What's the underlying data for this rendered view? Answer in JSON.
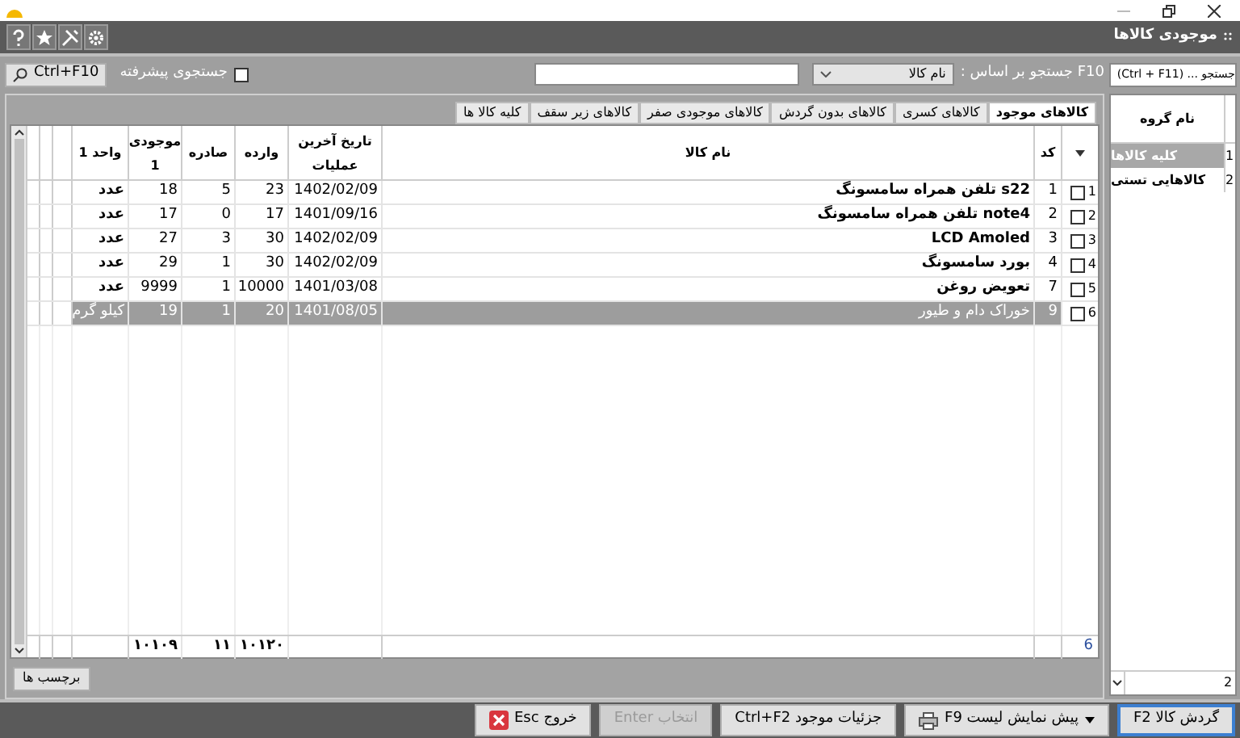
{
  "window": {
    "title": "موجودی کالاها"
  },
  "search": {
    "label": "F10 جستجو بر اساس :",
    "field_select": "نام کالا",
    "advanced_label": "جستجوی پیشرفته",
    "advanced_checked": false,
    "button": "Ctrl+F10",
    "group_placeholder": "جستجو ... (Ctrl + F11)"
  },
  "tabs": [
    {
      "label": "کالاهای موجود",
      "selected": true
    },
    {
      "label": "کالاهای کسری",
      "selected": false
    },
    {
      "label": "کالاهای بدون گردش",
      "selected": false
    },
    {
      "label": "کالاهای موجودی صفر",
      "selected": false
    },
    {
      "label": "کالاهای زیر سقف",
      "selected": false
    },
    {
      "label": "کلیه کالا ها",
      "selected": false
    }
  ],
  "table": {
    "columns": [
      "کد",
      "نام کالا",
      "تاریخ آخرین عملیات",
      "وارده",
      "صادره",
      "موجودی 1",
      "واحد 1"
    ],
    "rows": [
      {
        "row_number": "1",
        "checked": false,
        "code": "1",
        "name": "s22 تلفن همراه سامسونگ",
        "date": "1402/02/09",
        "in": "23",
        "out": "5",
        "stock": "18",
        "unit": "عدد",
        "selected": false
      },
      {
        "row_number": "2",
        "checked": false,
        "code": "2",
        "name": "note4 تلفن همراه سامسونگ",
        "date": "1401/09/16",
        "in": "17",
        "out": "0",
        "stock": "17",
        "unit": "عدد",
        "selected": false
      },
      {
        "row_number": "3",
        "checked": false,
        "code": "3",
        "name": "LCD Amoled",
        "date": "1402/02/09",
        "in": "30",
        "out": "3",
        "stock": "27",
        "unit": "عدد",
        "selected": false
      },
      {
        "row_number": "4",
        "checked": false,
        "code": "4",
        "name": "بورد سامسونگ",
        "date": "1402/02/09",
        "in": "30",
        "out": "1",
        "stock": "29",
        "unit": "عدد",
        "selected": false
      },
      {
        "row_number": "5",
        "checked": false,
        "code": "7",
        "name": "تعویض روغن",
        "date": "1401/03/08",
        "in": "10000",
        "out": "1",
        "stock": "9999",
        "unit": "عدد",
        "selected": false
      },
      {
        "row_number": "6",
        "checked": false,
        "code": "9",
        "name": "خوراک دام و طیور",
        "date": "1401/08/05",
        "in": "20",
        "out": "1",
        "stock": "19",
        "unit": "کیلو گرم",
        "selected": true
      }
    ],
    "footer": {
      "count": "6",
      "in_total": "۱۰۱۲۰",
      "out_total": "۱۱",
      "stock_total": "۱۰۱۰۹"
    }
  },
  "labels_button": "برچسب ها",
  "groups": {
    "header": "نام گروه",
    "items": [
      {
        "number": "1",
        "label": "کلیه کالاها",
        "selected": true
      },
      {
        "number": "2",
        "label": "کالاهایی تستی",
        "selected": false
      }
    ],
    "count": "2"
  },
  "buttons": [
    {
      "kind": "plain",
      "label": "گردش کالا F2",
      "focused": true,
      "disabled": false
    },
    {
      "kind": "print",
      "label": "پیش نمایش لیست F9",
      "focused": false,
      "disabled": false
    },
    {
      "kind": "plain",
      "label": "جزئیات موجود Ctrl+F2",
      "focused": false,
      "disabled": false
    },
    {
      "kind": "plain",
      "label": "انتخاب Enter",
      "focused": false,
      "disabled": true
    },
    {
      "kind": "exit",
      "label": "خروج Esc",
      "focused": false,
      "disabled": false
    }
  ]
}
